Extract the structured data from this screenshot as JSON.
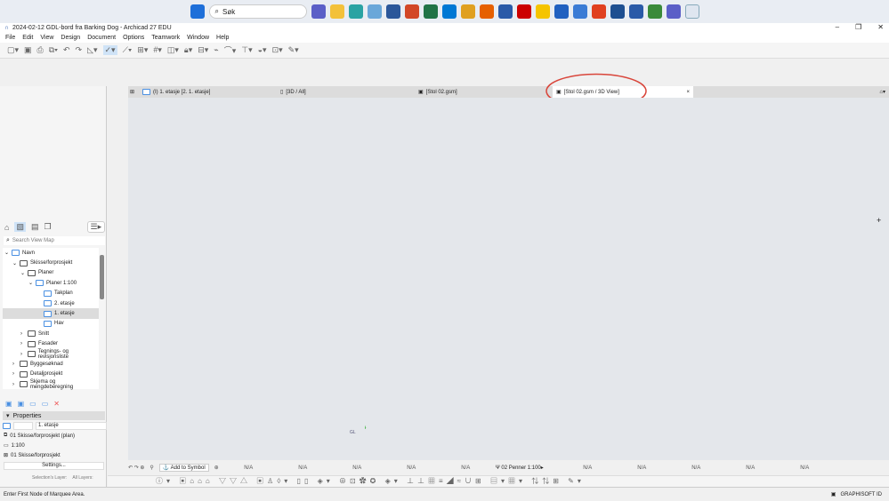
{
  "taskbar": {
    "search_placeholder": "Søk"
  },
  "window": {
    "title": "2024-02-12 GDL-bord fra Barking Dog - Archicad 27 EDU"
  },
  "menu": [
    "File",
    "Edit",
    "View",
    "Design",
    "Document",
    "Options",
    "Teamwork",
    "Window",
    "Help"
  ],
  "tabs": [
    {
      "label": "(I) 1. etasje [2. 1. etasje]"
    },
    {
      "label": "[3D / All]"
    },
    {
      "label": "[Stol 02.gsm]"
    },
    {
      "label": "[Stol 02.gsm / 3D View]",
      "close": "×",
      "active": true
    }
  ],
  "navigator": {
    "search_placeholder": "Search View Map",
    "items": [
      {
        "label": "Navn",
        "level": 0
      },
      {
        "label": "Skisse/forprosjekt",
        "level": 1
      },
      {
        "label": "Planer",
        "level": 2
      },
      {
        "label": "Planer 1:100",
        "level": 3
      },
      {
        "label": "Takplan",
        "level": 4
      },
      {
        "label": "2. etasje",
        "level": 4
      },
      {
        "label": "1. etasje",
        "level": 4,
        "selected": true
      },
      {
        "label": "Hav",
        "level": 4
      },
      {
        "label": "Snitt",
        "level": 2
      },
      {
        "label": "Fasader",
        "level": 2
      },
      {
        "label": "Tegnings- og revisjonsliste",
        "level": 2
      },
      {
        "label": "Byggesøknad",
        "level": 1
      },
      {
        "label": "Detaljprosjekt",
        "level": 1
      },
      {
        "label": "Skjema og mengdeberegning",
        "level": 1
      }
    ]
  },
  "properties": {
    "header": "Properties",
    "name": "1. etasje",
    "layer_combo": "01 Skisse/forprosjekt (plan)",
    "scale": "1:100",
    "model_view": "01 Skisse/forprosjekt",
    "settings_label": "Settings..."
  },
  "quick_options": {
    "selection_layer": "Selection's Layer:",
    "all_layers": "All Layers:"
  },
  "canvas": {
    "origin_label": "GL"
  },
  "bottom_bar": {
    "add_to_symbol": "Add to Symbol",
    "na": "N/A",
    "pen_set": "02 Penner 1:100"
  },
  "status": {
    "message": "Enter First Node of Marquee Area.",
    "graphisoft_id": "GRAPHISOFT ID"
  },
  "colors": {
    "accent": "#4a90e2",
    "annotation": "#d9453a"
  }
}
